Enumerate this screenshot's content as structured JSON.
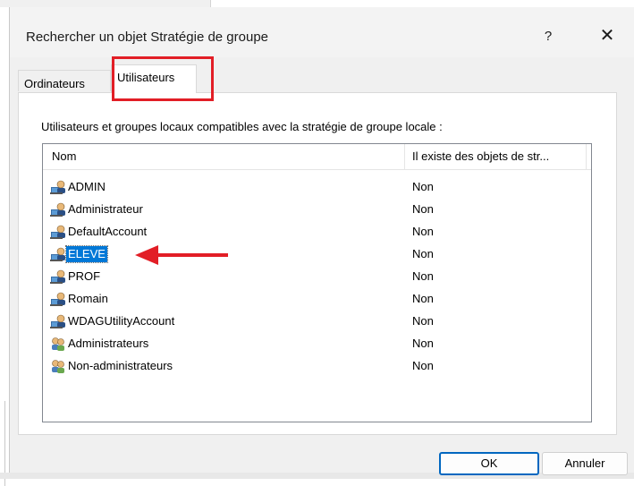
{
  "dialog": {
    "title": "Rechercher un objet Stratégie de groupe",
    "help_label": "?",
    "close_label": "✕"
  },
  "tabs": [
    {
      "label": "Ordinateurs",
      "selected": false
    },
    {
      "label": "Utilisateurs",
      "selected": true
    }
  ],
  "panel": {
    "description": "Utilisateurs et groupes locaux compatibles avec la stratégie de groupe locale :",
    "columns": [
      "Nom",
      "Il existe des objets de str..."
    ],
    "rows": [
      {
        "name": "ADMIN",
        "value": "Non",
        "icon": "user-icon"
      },
      {
        "name": "Administrateur",
        "value": "Non",
        "icon": "user-icon"
      },
      {
        "name": "DefaultAccount",
        "value": "Non",
        "icon": "user-icon"
      },
      {
        "name": "ELEVE",
        "value": "Non",
        "icon": "user-icon",
        "selected": true
      },
      {
        "name": "PROF",
        "value": "Non",
        "icon": "user-icon"
      },
      {
        "name": "Romain",
        "value": "Non",
        "icon": "user-icon"
      },
      {
        "name": "WDAGUtilityAccount",
        "value": "Non",
        "icon": "user-icon"
      },
      {
        "name": "Administrateurs",
        "value": "Non",
        "icon": "group-icon"
      },
      {
        "name": "Non-administrateurs",
        "value": "Non",
        "icon": "group-icon"
      }
    ]
  },
  "buttons": {
    "ok": "OK",
    "cancel": "Annuler"
  },
  "annotation": {
    "highlight_color": "#e21e26"
  }
}
